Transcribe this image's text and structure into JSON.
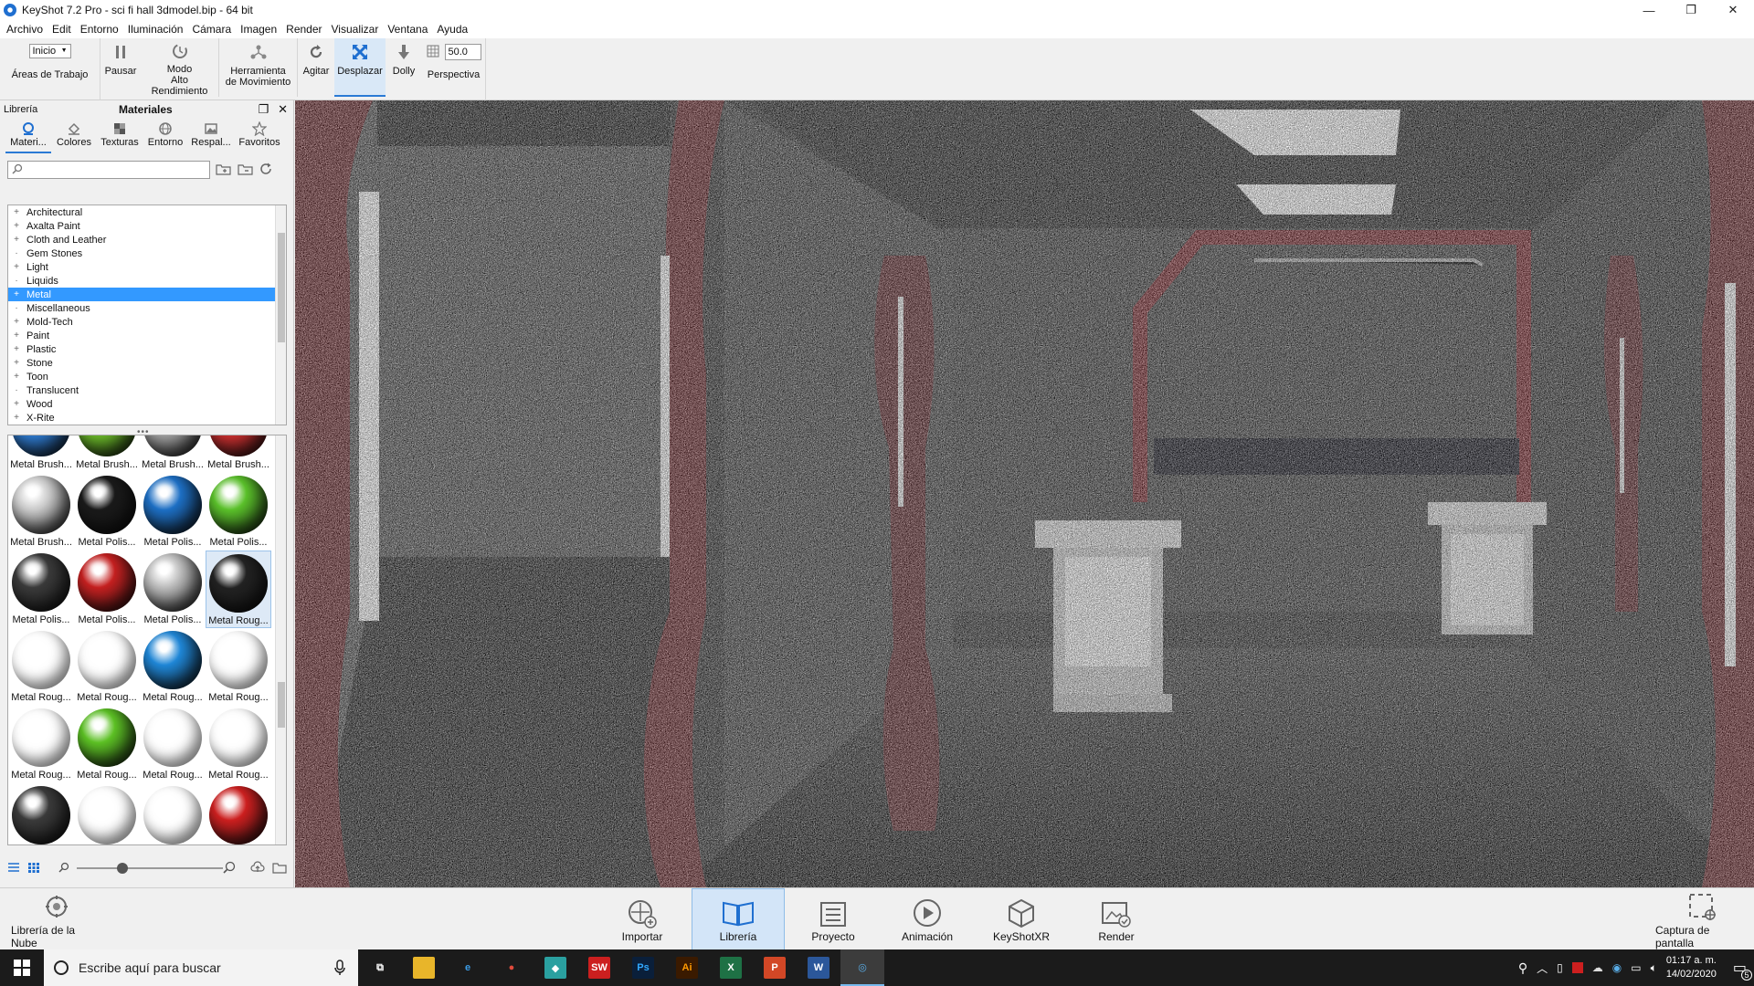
{
  "window": {
    "title": "KeyShot 7.2 Pro  - sci fi hall 3dmodel.bip  - 64 bit",
    "controls": [
      "—",
      "❐",
      "✕"
    ]
  },
  "menu": [
    "Archivo",
    "Edit",
    "Entorno",
    "Iluminación",
    "Cámara",
    "Imagen",
    "Render",
    "Visualizar",
    "Ventana",
    "Ayuda"
  ],
  "toolbar": {
    "workspace_select": "Inicio",
    "workspace_label": "Áreas de Trabajo",
    "pause": "Pausar",
    "perf_mode_line1": "Modo",
    "perf_mode_line2": "Alto Rendimiento",
    "move_tool_line1": "Herramienta",
    "move_tool_line2": "de Movimiento",
    "tumble": "Agitar",
    "pan": "Desplazar",
    "dolly": "Dolly",
    "fov_value": "50.0",
    "perspective": "Perspectiva"
  },
  "panel": {
    "library_label": "Librería",
    "title": "Materiales",
    "tabs": [
      "Materi...",
      "Colores",
      "Texturas",
      "Entorno",
      "Respal...",
      "Favoritos"
    ],
    "search_placeholder": "",
    "tree": [
      {
        "label": "Architectural",
        "expandable": true
      },
      {
        "label": "Axalta Paint",
        "expandable": true
      },
      {
        "label": "Cloth and Leather",
        "expandable": true
      },
      {
        "label": "Gem Stones",
        "expandable": false
      },
      {
        "label": "Light",
        "expandable": true
      },
      {
        "label": "Liquids",
        "expandable": false
      },
      {
        "label": "Metal",
        "expandable": true,
        "selected": true
      },
      {
        "label": "Miscellaneous",
        "expandable": false
      },
      {
        "label": "Mold-Tech",
        "expandable": true
      },
      {
        "label": "Paint",
        "expandable": true
      },
      {
        "label": "Plastic",
        "expandable": true
      },
      {
        "label": "Stone",
        "expandable": true
      },
      {
        "label": "Toon",
        "expandable": true
      },
      {
        "label": "Translucent",
        "expandable": false
      },
      {
        "label": "Wood",
        "expandable": true
      },
      {
        "label": "X-Rite",
        "expandable": true
      }
    ],
    "materials": [
      {
        "label": "Metal Brush...",
        "color": "#2f7fd8",
        "rough": false
      },
      {
        "label": "Metal Brush...",
        "color": "#6fc12a",
        "rough": false
      },
      {
        "label": "Metal Brush...",
        "color": "#a8a8a8",
        "rough": false
      },
      {
        "label": "Metal Brush...",
        "color": "#d43030",
        "rough": false
      },
      {
        "label": "Metal Brush...",
        "color": "#c9c9c9",
        "rough": false
      },
      {
        "label": "Metal Polis...",
        "color": "#1a1a1a",
        "rough": false
      },
      {
        "label": "Metal Polis...",
        "color": "#1d6fc4",
        "rough": false
      },
      {
        "label": "Metal Polis...",
        "color": "#5ac02a",
        "rough": false
      },
      {
        "label": "Metal Polis...",
        "color": "#3a3a3a",
        "rough": false
      },
      {
        "label": "Metal Polis...",
        "color": "#c42020",
        "rough": false
      },
      {
        "label": "Metal Polis...",
        "color": "#bcbcbc",
        "rough": false
      },
      {
        "label": "Metal Roug...",
        "color": "#222222",
        "rough": false,
        "selected": true
      },
      {
        "label": "Metal Roug...",
        "color": "#3a3a3a",
        "rough": true
      },
      {
        "label": "Metal Roug...",
        "color": "#6a6a6a",
        "rough": true
      },
      {
        "label": "Metal Roug...",
        "color": "#1f86d6",
        "rough": false
      },
      {
        "label": "Metal Roug...",
        "color": "#2a8fd8",
        "rough": true
      },
      {
        "label": "Metal Roug...",
        "color": "#4f9fd8",
        "rough": true
      },
      {
        "label": "Metal Roug...",
        "color": "#5cc024",
        "rough": false
      },
      {
        "label": "Metal Roug...",
        "color": "#6fbf3a",
        "rough": true
      },
      {
        "label": "Metal Roug...",
        "color": "#8fbf60",
        "rough": true
      },
      {
        "label": "",
        "color": "#3a3a3a",
        "rough": false
      },
      {
        "label": "",
        "color": "#8a8a8a",
        "rough": true
      },
      {
        "label": "",
        "color": "#b0b0b0",
        "rough": true
      },
      {
        "label": "",
        "color": "#cc1f1f",
        "rough": false
      }
    ],
    "zoom_level": 0.3
  },
  "ribbon": {
    "cloud_library": "Librería de la Nube",
    "import": "Importar",
    "library": "Librería",
    "project": "Proyecto",
    "animation": "Animación",
    "keyshotxr": "KeyShotXR",
    "render": "Render",
    "screenshot": "Captura de pantalla"
  },
  "taskbar": {
    "search_placeholder": "Escribe aquí para buscar",
    "apps": [
      {
        "name": "task-view",
        "label": "⧉",
        "bg": "transparent",
        "fg": "#ffffff"
      },
      {
        "name": "file-explorer",
        "label": "▬",
        "bg": "#e8b52a",
        "fg": "#e8b52a"
      },
      {
        "name": "edge",
        "label": "e",
        "bg": "transparent",
        "fg": "#3b9de8"
      },
      {
        "name": "chrome",
        "label": "●",
        "bg": "transparent",
        "fg": "#e04a3c"
      },
      {
        "name": "store",
        "label": "◆",
        "bg": "#2aa0a0",
        "fg": "#ffffff"
      },
      {
        "name": "solidworks",
        "label": "SW",
        "bg": "#cc1f1f",
        "fg": "#ffffff"
      },
      {
        "name": "photoshop",
        "label": "Ps",
        "bg": "#0a1f3a",
        "fg": "#31a8ff"
      },
      {
        "name": "illustrator",
        "label": "Ai",
        "bg": "#3a1a00",
        "fg": "#ff9a00"
      },
      {
        "name": "excel",
        "label": "X",
        "bg": "#1e7145",
        "fg": "#ffffff"
      },
      {
        "name": "powerpoint",
        "label": "P",
        "bg": "#d24726",
        "fg": "#ffffff"
      },
      {
        "name": "word",
        "label": "W",
        "bg": "#2b579a",
        "fg": "#ffffff"
      },
      {
        "name": "keyshot",
        "label": "◎",
        "bg": "transparent",
        "fg": "#5aaee8",
        "active": true
      }
    ],
    "time": "01:17 a. m.",
    "date": "14/02/2020",
    "notifications": "5"
  }
}
